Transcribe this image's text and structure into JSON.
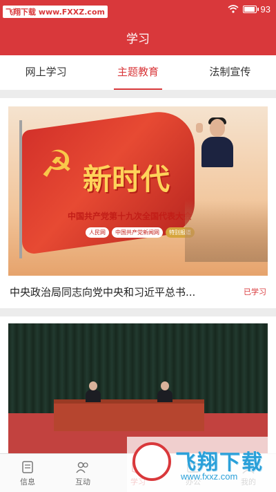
{
  "status": {
    "watermark": "飞翔下载 www.FXXZ.com",
    "battery": "93",
    "battery_level": 0.93
  },
  "header": {
    "title": "学习"
  },
  "tabs": [
    {
      "label": "网上学习"
    },
    {
      "label": "主题教育"
    },
    {
      "label": "法制宣传"
    }
  ],
  "cards": [
    {
      "image": {
        "headline": "新时代",
        "subhead": "中国共产党第十九次全国代表大会",
        "badges": [
          "人民网",
          "中国共产党新闻网",
          "特别报道"
        ]
      },
      "title": "中央政治局同志向党中央和习近平总书...",
      "tag": "已学习"
    },
    {
      "image": {
        "description_icon": "meeting-photo"
      }
    }
  ],
  "bottom_nav": [
    {
      "label": "信息",
      "icon": "news-icon"
    },
    {
      "label": "互动",
      "icon": "people-icon"
    },
    {
      "label": "学习",
      "icon": "study-icon"
    },
    {
      "label": "办公",
      "icon": "office-icon"
    },
    {
      "label": "我的",
      "icon": "profile-icon"
    }
  ],
  "watermark_bottom": {
    "text": "飞翔下载",
    "url": "www.fxxz.com"
  },
  "colors": {
    "accent": "#d9383b",
    "watermark": "#2aa0d9"
  }
}
